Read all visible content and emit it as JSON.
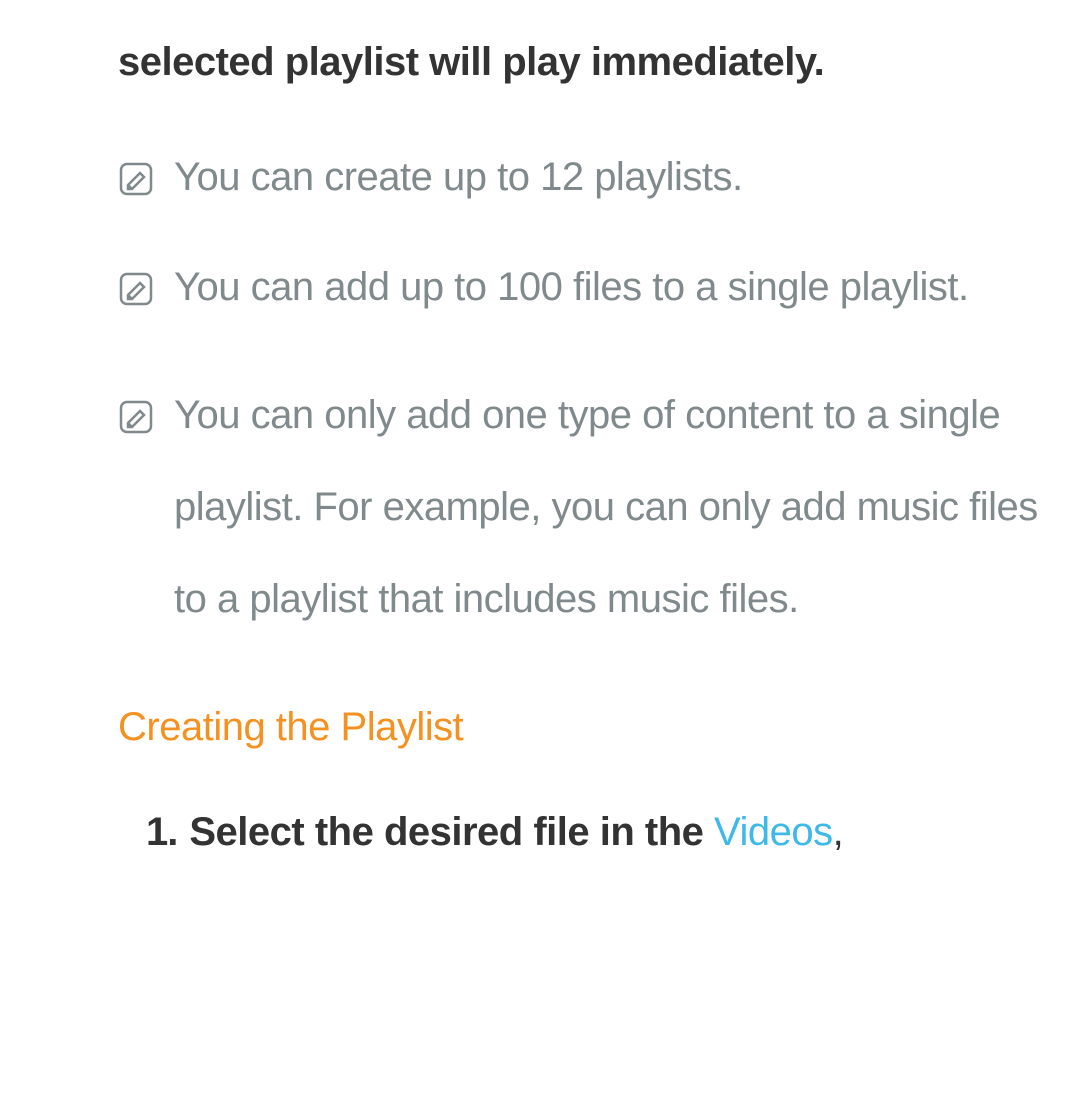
{
  "intro": "selected playlist will play immediately.",
  "notes": [
    "You can create up to 12 playlists.",
    "You can add up to 100 files to a single playlist.",
    "You can only add one type of content to a single playlist. For example, you can only add music files to a playlist that includes music files."
  ],
  "section_heading": "Creating the Playlist",
  "steps": [
    {
      "number": "1.",
      "text_prefix": "Select the desired file in the ",
      "link": "Videos",
      "text_suffix": ","
    }
  ]
}
